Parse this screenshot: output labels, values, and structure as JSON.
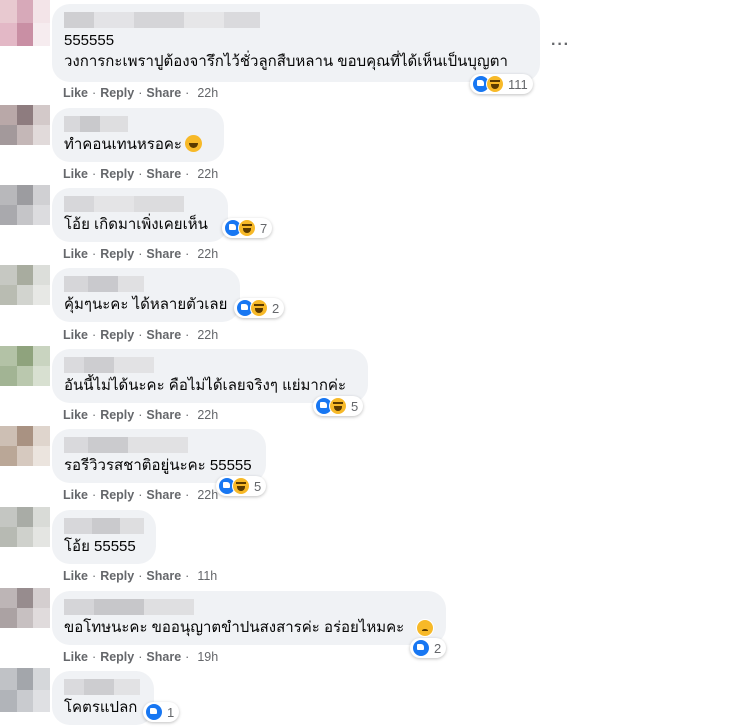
{
  "actions": {
    "like": "Like",
    "reply": "Reply",
    "share": "Share",
    "sep": "·"
  },
  "more_options": "···",
  "comments": [
    {
      "text_lines": [
        "555555",
        "วงการกะเพราปูต้องจารึกไว้ชั่วลูกสืบหลาน ขอบคุณที่ได้เห็นเป็นบุญตา"
      ],
      "time": "22h",
      "reactions": {
        "types": [
          "like",
          "haha"
        ],
        "count": "111"
      }
    },
    {
      "text_lines": [
        "ทำคอนเทนหรอคะ"
      ],
      "inline_emoji": "haha-emoji",
      "time": "22h",
      "reactions": null
    },
    {
      "text_lines": [
        "โอ้ย เกิดมาเพิ่งเคยเห็น"
      ],
      "time": "22h",
      "reactions": {
        "types": [
          "like",
          "haha"
        ],
        "count": "7"
      }
    },
    {
      "text_lines": [
        "คุ้มๆนะคะ ได้หลายตัวเลย"
      ],
      "time": "22h",
      "reactions": {
        "types": [
          "like",
          "haha"
        ],
        "count": "2"
      }
    },
    {
      "text_lines": [
        "อันนี้ไม่ได้นะคะ คือไม่ได้เลยจริงๆ แย่มากค่ะ"
      ],
      "time": "22h",
      "reactions": {
        "types": [
          "like",
          "haha"
        ],
        "count": "5"
      }
    },
    {
      "text_lines": [
        "รอรีวิวรสชาติอยู่นะคะ 55555"
      ],
      "time": "22h",
      "reactions": {
        "types": [
          "like",
          "haha"
        ],
        "count": "5"
      }
    },
    {
      "text_lines": [
        "โอ้ย 55555"
      ],
      "time": "11h",
      "reactions": null
    },
    {
      "text_lines": [
        "ขอโทษนะคะ ขออนุญาตขำปนสงสารค่ะ อร่อยไหมคะ"
      ],
      "time": "19h",
      "reactions": {
        "types": [
          "like",
          "sad"
        ],
        "count": "2"
      }
    },
    {
      "text_lines": [
        "โคตรแปลก"
      ],
      "time": "",
      "reactions": {
        "types": [
          "like"
        ],
        "count": "1"
      }
    }
  ],
  "colors": {
    "bubble": "#f0f2f5",
    "muted": "#65676b",
    "like_blue": "#1877f2",
    "emoji_yellow": "#f7b928"
  }
}
